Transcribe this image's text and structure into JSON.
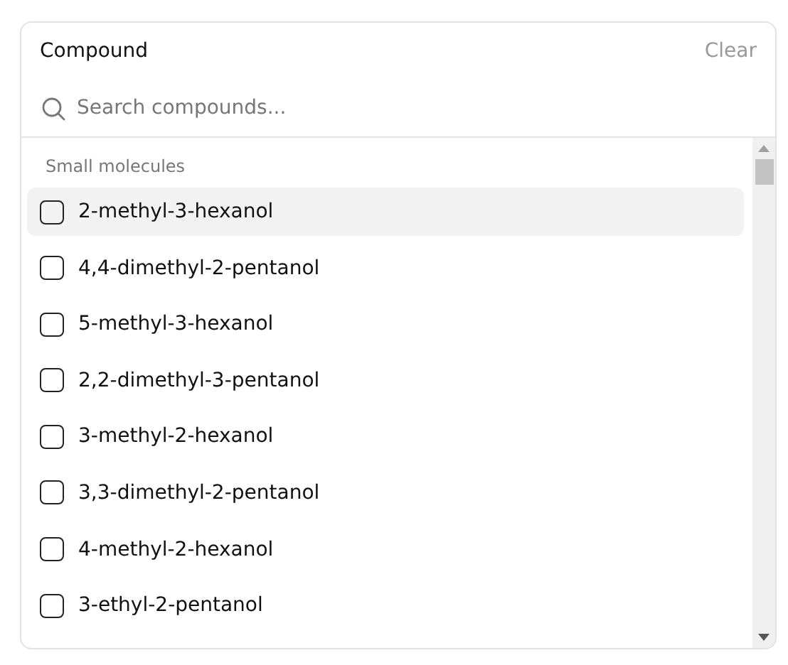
{
  "header": {
    "title": "Compound",
    "clear": "Clear"
  },
  "search": {
    "placeholder": "Search compounds..."
  },
  "group": {
    "label": "Small molecules"
  },
  "items": [
    {
      "label": "2-methyl-3-hexanol",
      "checked": false,
      "highlighted": true
    },
    {
      "label": "4,4-dimethyl-2-pentanol",
      "checked": false,
      "highlighted": false
    },
    {
      "label": "5-methyl-3-hexanol",
      "checked": false,
      "highlighted": false
    },
    {
      "label": "2,2-dimethyl-3-pentanol",
      "checked": false,
      "highlighted": false
    },
    {
      "label": "3-methyl-2-hexanol",
      "checked": false,
      "highlighted": false
    },
    {
      "label": "3,3-dimethyl-2-pentanol",
      "checked": false,
      "highlighted": false
    },
    {
      "label": "4-methyl-2-hexanol",
      "checked": false,
      "highlighted": false
    },
    {
      "label": "3-ethyl-2-pentanol",
      "checked": false,
      "highlighted": false
    }
  ]
}
